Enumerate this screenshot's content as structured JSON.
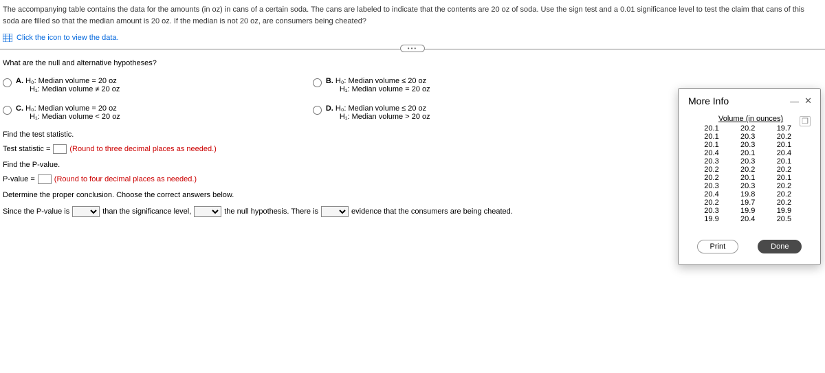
{
  "intro": "The accompanying table contains the data for the amounts (in oz) in cans of a certain soda. The cans are labeled to indicate that the contents are 20 oz of soda. Use the sign test and a 0.01 significance level to test the claim that cans of this soda are filled so that the median amount is 20 oz. If the median is not 20 oz, are consumers being cheated?",
  "view_data_link": "Click the icon to view the data.",
  "q_hypotheses": "What are the null and alternative hypotheses?",
  "options": {
    "A": {
      "tag": "A.",
      "l1": "H₀: Median volume = 20 oz",
      "l2": "H₁: Median volume ≠ 20 oz"
    },
    "B": {
      "tag": "B.",
      "l1": "H₀: Median volume ≤ 20 oz",
      "l2": "H₁: Median volume = 20 oz"
    },
    "C": {
      "tag": "C.",
      "l1": "H₀: Median volume = 20 oz",
      "l2": "H₁: Median volume < 20 oz"
    },
    "D": {
      "tag": "D.",
      "l1": "H₀: Median volume ≤ 20 oz",
      "l2": "H₁: Median volume > 20 oz"
    }
  },
  "find_stat": "Find the test statistic.",
  "stat_prefix": "Test statistic =",
  "stat_hint": "(Round to three decimal places as needed.)",
  "find_p": "Find the P-value.",
  "p_prefix": "P-value =",
  "p_hint": "(Round to four decimal places as needed.)",
  "conclusion_q": "Determine the proper conclusion. Choose the correct answers below.",
  "concl": {
    "p1": "Since the P-value is",
    "p2": "than the significance level,",
    "p3": "the null hypothesis. There is",
    "p4": "evidence that the consumers are being cheated."
  },
  "modal": {
    "title": "More Info",
    "header": "Volume (in ounces)",
    "data": [
      [
        "20.1",
        "20.2",
        "19.7"
      ],
      [
        "20.1",
        "20.3",
        "20.2"
      ],
      [
        "20.1",
        "20.3",
        "20.1"
      ],
      [
        "20.4",
        "20.1",
        "20.4"
      ],
      [
        "20.3",
        "20.3",
        "20.1"
      ],
      [
        "20.2",
        "20.2",
        "20.2"
      ],
      [
        "20.2",
        "20.1",
        "20.1"
      ],
      [
        "20.3",
        "20.3",
        "20.2"
      ],
      [
        "20.4",
        "19.8",
        "20.2"
      ],
      [
        "20.2",
        "19.7",
        "20.2"
      ],
      [
        "20.3",
        "19.9",
        "19.9"
      ],
      [
        "19.9",
        "20.4",
        "20.5"
      ]
    ],
    "print": "Print",
    "done": "Done"
  }
}
